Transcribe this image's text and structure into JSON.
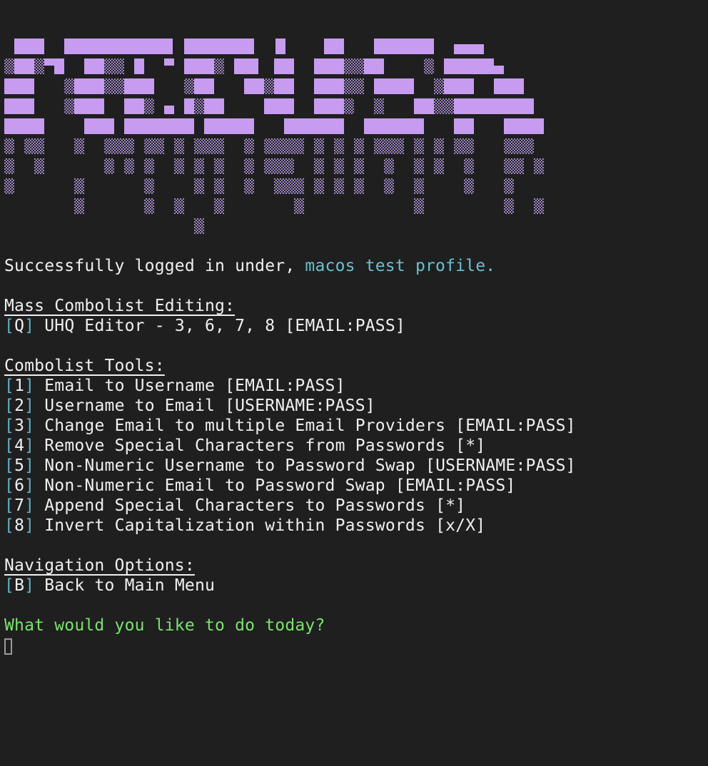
{
  "banner": {
    "accent": "#c79cf0",
    "shade": "#9e86c4"
  },
  "login": {
    "prefix": "Successfully logged in under, ",
    "profile": "macos test profile."
  },
  "sections": [
    {
      "heading": "Mass Combolist Editing:",
      "items": [
        {
          "key": "Q",
          "label": " UHQ Editor - 3, 6, 7, 8 [EMAIL:PASS]"
        }
      ]
    },
    {
      "heading": "Combolist Tools:",
      "items": [
        {
          "key": "1",
          "label": " Email to Username [EMAIL:PASS]"
        },
        {
          "key": "2",
          "label": " Username to Email [USERNAME:PASS]"
        },
        {
          "key": "3",
          "label": " Change Email to multiple Email Providers [EMAIL:PASS]"
        },
        {
          "key": "4",
          "label": " Remove Special Characters from Passwords [*]"
        },
        {
          "key": "5",
          "label": " Non-Numeric Username to Password Swap [USERNAME:PASS]"
        },
        {
          "key": "6",
          "label": " Non-Numeric Email to Password Swap [EMAIL:PASS]"
        },
        {
          "key": "7",
          "label": " Append Special Characters to Passwords [*]"
        },
        {
          "key": "8",
          "label": " Invert Capitalization within Passwords [x/X]"
        }
      ]
    },
    {
      "heading": "Navigation Options:",
      "items": [
        {
          "key": "B",
          "label": " Back to Main Menu"
        }
      ]
    }
  ],
  "prompt": "What would you like to do today?",
  "colors": {
    "background": "#1f1f1f",
    "text": "#f0f0f0",
    "bracket": "#5fb3c7",
    "profile": "#66c2d0",
    "prompt": "#7be36b"
  }
}
